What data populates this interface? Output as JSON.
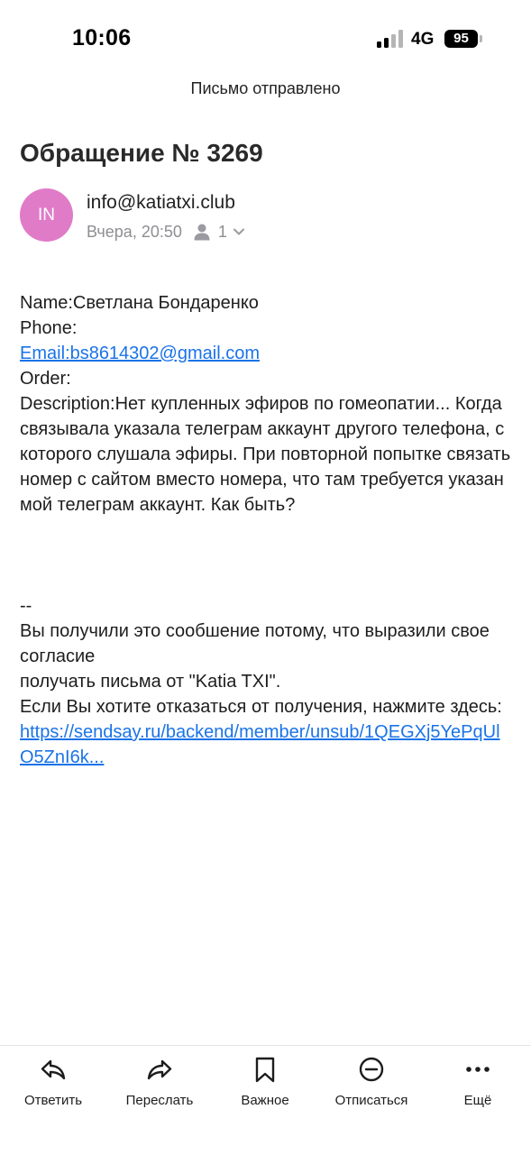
{
  "status_bar": {
    "time": "10:06",
    "network": "4G",
    "battery": "95"
  },
  "banner": {
    "text": "Письмо отправлено"
  },
  "email": {
    "subject": "Обращение № 3269",
    "avatar_initials": "IN",
    "avatar_color": "#e07bc8",
    "sender": "info@katiatxi.club",
    "date": "Вчера, 20:50",
    "recipient_count": "1",
    "body": {
      "name_line": "Name:Светлана Бондаренко",
      "phone_line": "Phone:",
      "email_link": "Email:bs8614302@gmail.com",
      "order_line": "Order:",
      "description": "Description:Нет купленных эфиров по гомеопатии... Когда связывала указала телеграм аккаунт другого телефона, с которого слушала эфиры. При повторной попытке связать номер с сайтом вместо номера, что там требуется указан мой телеграм аккаунт. Как быть?",
      "separator": "--",
      "footer_line1": "Вы получили это сообшение потому, что выразили свое согласие",
      "footer_line2": "получать письма от \"Katia TXI\".",
      "footer_line3": "Если Вы хотите отказаться от получения, нажмите здесь:",
      "unsub_link": "https://sendsay.ru/backend/member/unsub/1QEGXj5YePqUlO5ZnI6k..."
    }
  },
  "toolbar": {
    "reply": "Ответить",
    "forward": "Переслать",
    "important": "Важное",
    "unsubscribe": "Отписаться",
    "more": "Ещё"
  },
  "colors": {
    "link": "#1a73e8",
    "muted": "#8e8e93"
  }
}
